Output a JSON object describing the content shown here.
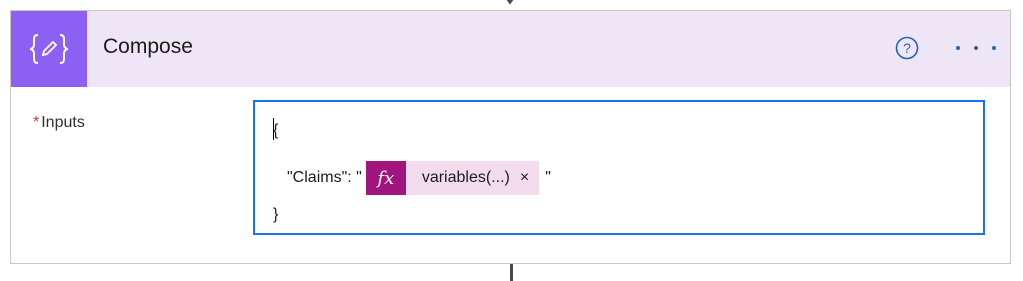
{
  "action": {
    "title": "Compose",
    "icon": "curly-braces-pencil-icon",
    "accent_color": "#8c60f3",
    "header_bg": "#eee5f7"
  },
  "header_buttons": {
    "help": "help-circle-icon",
    "more": "more-options-icon"
  },
  "inputs_field": {
    "required_marker": "*",
    "label": "Inputs",
    "line1": "{",
    "line2_prefix": "\"Claims\": \"",
    "line2_suffix": "\"",
    "line3": "}",
    "token": {
      "icon_text": "fx",
      "label": "variables(...)",
      "remove": "×",
      "color": "#a0167e"
    }
  }
}
